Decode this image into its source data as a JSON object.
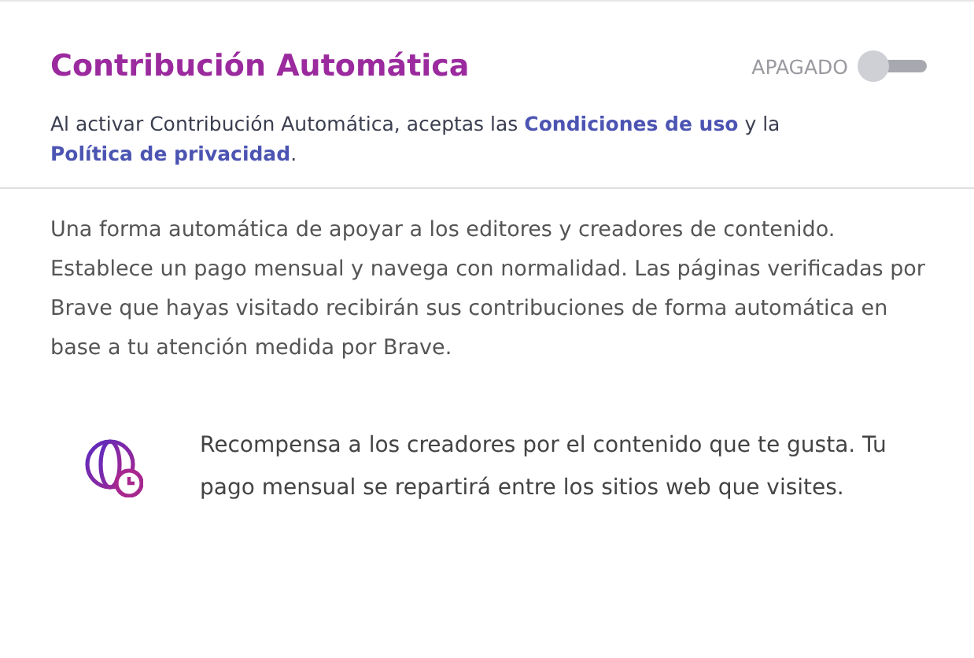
{
  "header": {
    "title": "Contribución Automática",
    "toggle": {
      "label": "APAGADO",
      "on": false
    },
    "terms": [
      {
        "kind": "text",
        "text": "Al activar Contribución Automática, aceptas las "
      },
      {
        "kind": "link",
        "text": "Condiciones de uso"
      },
      {
        "kind": "text",
        "text": " y la "
      },
      {
        "kind": "link",
        "text": "Política de privacidad"
      },
      {
        "kind": "text",
        "text": "."
      }
    ]
  },
  "description": "Una forma automática de apoyar a los editores y creadores de contenido. Establece un pago mensual y navega con normalidad. Las páginas verificadas por Brave que hayas visitado recibirán sus contribuciones de forma automática en base a tu atención medida por Brave.",
  "feature": {
    "text": "Recompensa a los creadores por el contenido que te gusta. Tu pago mensual se repartirá entre los sitios web que visites."
  }
}
